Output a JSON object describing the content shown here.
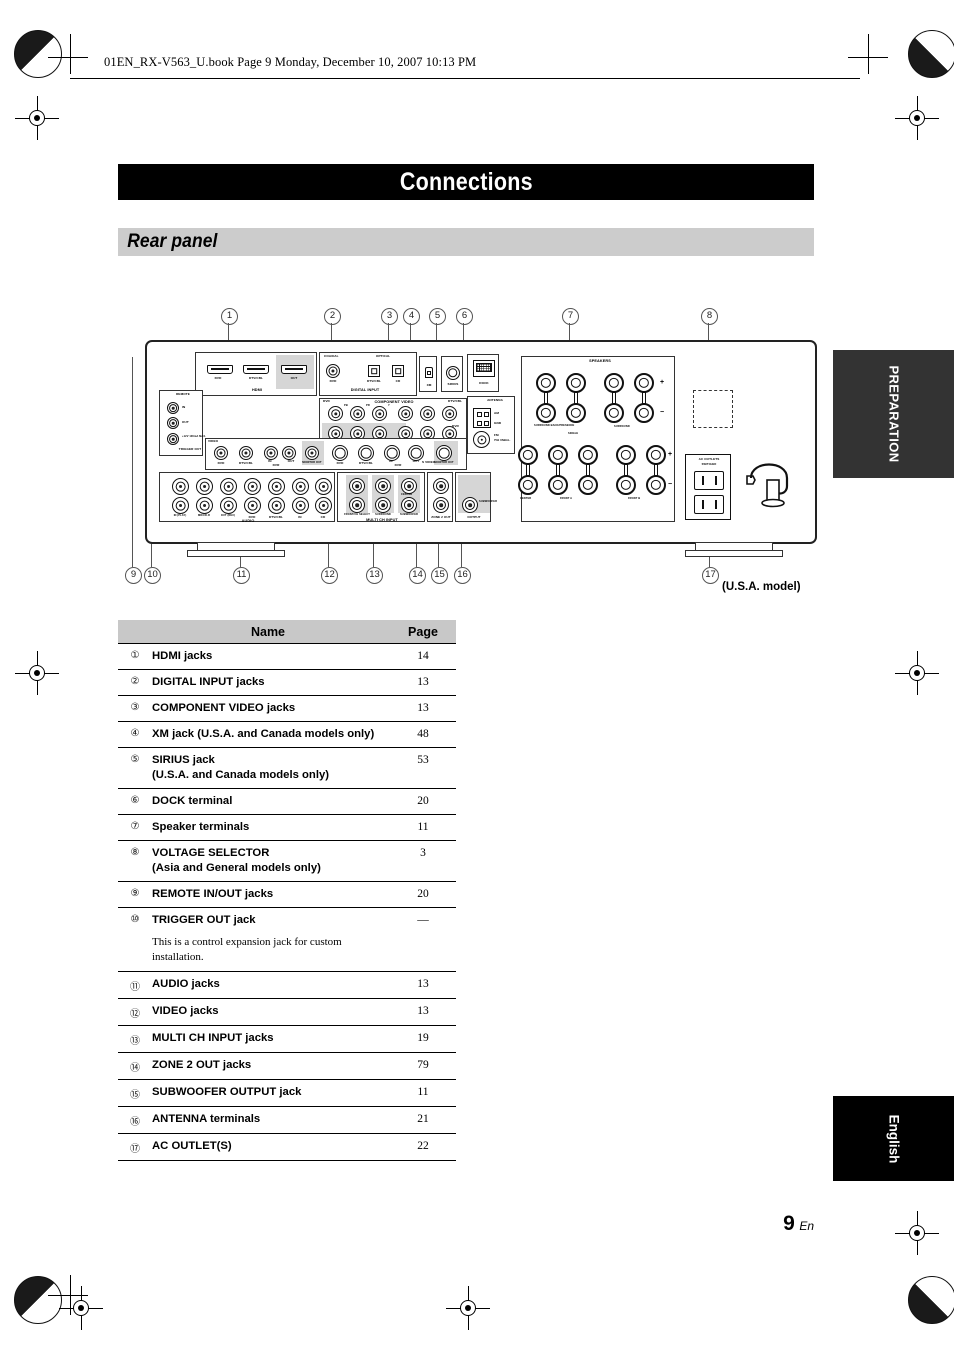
{
  "running_head": "01EN_RX-V563_U.book  Page 9  Monday, December 10, 2007  10:13 PM",
  "chapter_title": "Connections",
  "section_title": "Rear panel",
  "side_tabs": {
    "preparation": "PREPARATION",
    "language": "English"
  },
  "folio": {
    "page_number": "9",
    "language_suffix": "En"
  },
  "figure": {
    "model_note": "(U.S.A. model)",
    "callouts_top": [
      "1",
      "2",
      "3",
      "4",
      "5",
      "6",
      "7",
      "8"
    ],
    "callouts_bottom": [
      "9",
      "10",
      "11",
      "12",
      "13",
      "14",
      "15",
      "16",
      "17"
    ],
    "panel_labels": {
      "hdmi_group": "HDMI",
      "hdmi_dvd": "DVD",
      "hdmi_dtvcbl": "DTV/CBL",
      "hdmi_out": "OUT",
      "digital_input": "DIGITAL INPUT",
      "coaxial": "COAXIAL",
      "optical": "OPTICAL",
      "digital_dvd": "DVD",
      "digital_dtvcbl": "DTV/CBL",
      "digital_cd": "CD",
      "component_video": "COMPONENT VIDEO",
      "comp_dvd": "DVD",
      "comp_dtvcbl": "DTV/CBL",
      "comp_dvr": "DVR",
      "monitor_out": "MONITOR OUT",
      "comp_y": "Y",
      "comp_pb": "PB",
      "comp_pr": "PR",
      "xm": "XM",
      "sirius": "SIRIUS",
      "dock": "DOCK",
      "antenna": "ANTENNA",
      "antenna_am": "AM",
      "antenna_gnd": "GND",
      "antenna_fm": "FM",
      "antenna_ohm": "75Ω UNBAL.",
      "remote": "REMOTE",
      "remote_in": "IN",
      "remote_out": "OUT",
      "trigger_out": "TRIGGER OUT",
      "trigger_spec": "+12V 100mA MAX.",
      "video_group": "VIDEO",
      "video_dvd": "DVD",
      "video_dtvcbl": "DTV/CBL",
      "video_in": "IN",
      "video_dvr": "DVR",
      "video_out": "OUT",
      "video_monitor_out": "MONITOR OUT",
      "s_video": "S VIDEO",
      "audio_group": "AUDIO",
      "audio_in_play": "IN (PLAY)",
      "audio_md_cdr": "MD/CD-R",
      "audio_out_rec": "OUT (REC)",
      "audio_dvd": "DVD",
      "audio_dtvcbl": "DTV/CBL",
      "audio_in": "IN",
      "audio_dvr": "DVR",
      "audio_out": "OUT",
      "audio_cd": "CD",
      "multi_ch_input": "MULTI CH INPUT",
      "multi_front": "FRONT/CH SELECT",
      "multi_surround": "SURROUND",
      "multi_subwoofer": "SUBWOOFER",
      "multi_center": "CENTER",
      "zone2_out": "ZONE 2 OUT",
      "output": "OUTPUT",
      "output_subwoofer": "SUBWOOFER",
      "speakers": "SPEAKERS",
      "spk_sbk_presence": "SURROUND BACK/PRESENCE",
      "spk_single": "SINGLE",
      "spk_surround": "SURROUND",
      "spk_center": "CENTER",
      "spk_front_a": "FRONT A",
      "spk_front_b": "FRONT B",
      "spk_plus": "+",
      "spk_minus": "−",
      "spk_r": "R",
      "spk_l": "L",
      "ac_outlets": "AC OUTLETS",
      "ac_switched": "SWITCHED"
    }
  },
  "table": {
    "columns": {
      "name": "Name",
      "page": "Page"
    },
    "rows": [
      {
        "num": "1",
        "name": "HDMI jacks",
        "page": "14"
      },
      {
        "num": "2",
        "name": "DIGITAL INPUT jacks",
        "page": "13"
      },
      {
        "num": "3",
        "name": "COMPONENT VIDEO jacks",
        "page": "13"
      },
      {
        "num": "4",
        "name": "XM jack (U.S.A. and Canada models only)",
        "page": "48"
      },
      {
        "num": "5",
        "name": "SIRIUS jack\n(U.S.A. and Canada models only)",
        "page": "53"
      },
      {
        "num": "6",
        "name": "DOCK terminal",
        "page": "20"
      },
      {
        "num": "7",
        "name": "Speaker terminals",
        "page": "11"
      },
      {
        "num": "8",
        "name": "VOLTAGE SELECTOR\n(Asia and General models only)",
        "page": "3"
      },
      {
        "num": "9",
        "name": "REMOTE IN/OUT jacks",
        "page": "20"
      },
      {
        "num": "10",
        "name": "TRIGGER OUT jack",
        "page": "—",
        "note": "This is a control expansion jack for custom installation."
      },
      {
        "num": "11",
        "name": "AUDIO jacks",
        "page": "13"
      },
      {
        "num": "12",
        "name": "VIDEO jacks",
        "page": "13"
      },
      {
        "num": "13",
        "name": "MULTI CH INPUT jacks",
        "page": "19"
      },
      {
        "num": "14",
        "name": "ZONE 2 OUT jacks",
        "page": "79"
      },
      {
        "num": "15",
        "name": "SUBWOOFER OUTPUT jack",
        "page": "11"
      },
      {
        "num": "16",
        "name": "ANTENNA terminals",
        "page": "21"
      },
      {
        "num": "17",
        "name": "AC OUTLET(S)",
        "page": "22"
      }
    ]
  }
}
